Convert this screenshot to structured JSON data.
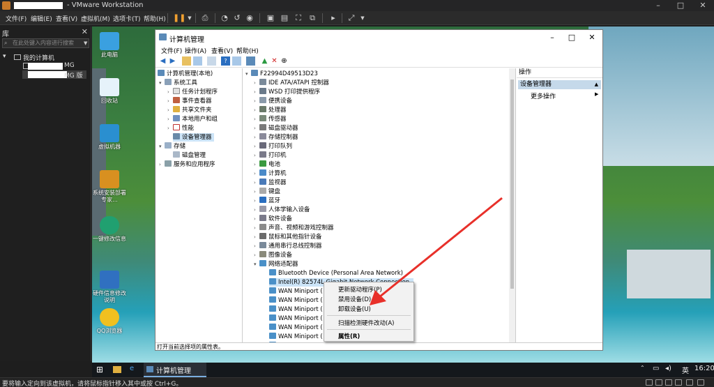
{
  "vm": {
    "title": "- VMware Workstation",
    "menu": [
      "文件(F)",
      "编辑(E)",
      "查看(V)",
      "虚拟机(M)",
      "选项卡(T)",
      "帮助(H)"
    ],
    "library_title": "库",
    "search_placeholder": "在此处键入内容进行搜索",
    "tree_root": "我的计算机",
    "tree_child1": "MG",
    "tree_child2": "MG 版",
    "status_text": "要将输入定向到该虚拟机，请将鼠标指针移入其中或按 Ctrl+G。"
  },
  "desktop": {
    "icons": [
      "此电脑",
      "回收站",
      "虚拟机器",
      "系统安装部署专家...",
      "一键修改信息",
      "硬件信息修改说明",
      "QQ浏览器"
    ]
  },
  "guest_taskbar": {
    "app_label": "计算机管理",
    "lang": "英",
    "time": "16:20"
  },
  "cm": {
    "title": "计算机管理",
    "menu": [
      "文件(F)",
      "操作(A)",
      "查看(V)",
      "帮助(H)"
    ],
    "left_tree": {
      "root": "计算机管理(本地)",
      "system_tools": "系统工具",
      "task_scheduler": "任务计划程序",
      "event_viewer": "事件查看器",
      "shared_folders": "共享文件夹",
      "local_users": "本地用户和组",
      "performance": "性能",
      "device_manager": "设备管理器",
      "storage": "存储",
      "disk_management": "磁盘管理",
      "services": "服务和应用程序"
    },
    "device_root": "F22994D49513D23",
    "devices": [
      "IDE ATA/ATAPI 控制器",
      "WSD 打印提供程序",
      "便携设备",
      "处理器",
      "传感器",
      "磁盘驱动器",
      "存储控制器",
      "打印队列",
      "打印机",
      "电池",
      "计算机",
      "监视器",
      "键盘",
      "蓝牙",
      "人体学输入设备",
      "软件设备",
      "声音、视频和游戏控制器",
      "鼠标和其他指针设备",
      "通用串行总线控制器",
      "图像设备"
    ],
    "network_adapters": "网络适配器",
    "adapters": [
      "Bluetooth Device (Personal Area Network)",
      "Intel(R) 82574L Gigabit Network Connection",
      "WAN Miniport (",
      "WAN Miniport (",
      "WAN Miniport (",
      "WAN Miniport (",
      "WAN Miniport (",
      "WAN Miniport (",
      "WAN Miniport ("
    ],
    "actions_title": "操作",
    "actions_section": "设备管理器",
    "actions_more": "更多操作",
    "status": "打开当前选择项的属性表。"
  },
  "context_menu": {
    "update": "更新驱动程序(P)",
    "disable": "禁用设备(D)",
    "uninstall": "卸载设备(U)",
    "scan": "扫描检测硬件改动(A)",
    "properties": "属性(R)"
  }
}
